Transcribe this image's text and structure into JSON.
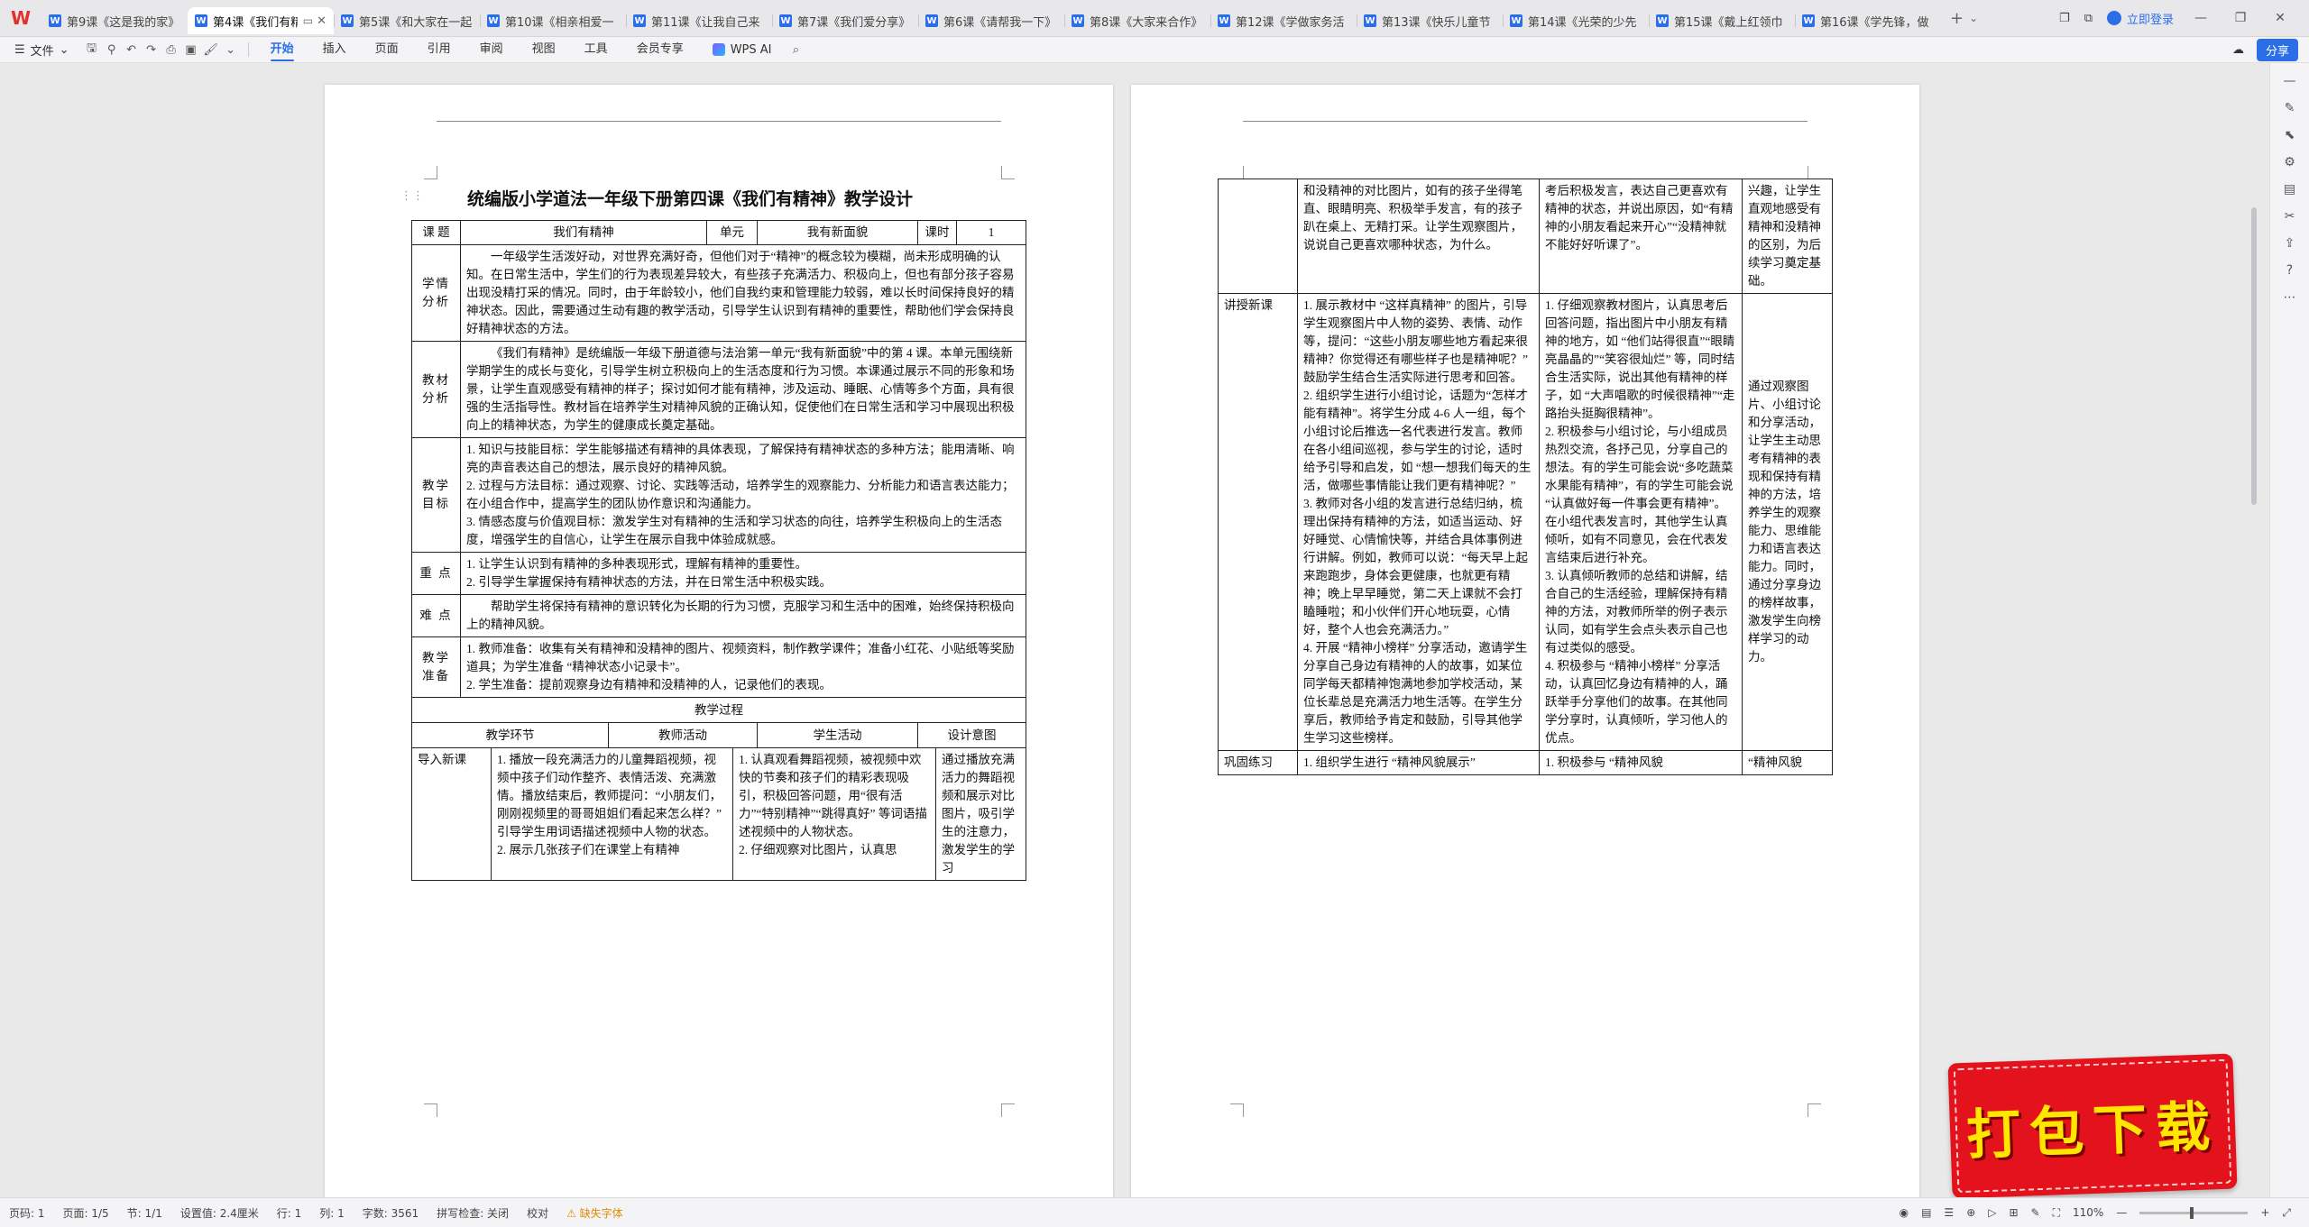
{
  "app": {
    "logo_text": "W",
    "tabs": [
      {
        "label": "第9课《这是我的家》",
        "active": false
      },
      {
        "label": "第4课《我们有精",
        "active": true
      },
      {
        "label": "第5课《和大家在一起",
        "active": false
      },
      {
        "label": "第10课《相亲相爱一",
        "active": false
      },
      {
        "label": "第11课《让我自己来",
        "active": false
      },
      {
        "label": "第7课《我们爱分享》",
        "active": false
      },
      {
        "label": "第6课《请帮我一下》",
        "active": false
      },
      {
        "label": "第8课《大家来合作》",
        "active": false
      },
      {
        "label": "第12课《学做家务活",
        "active": false
      },
      {
        "label": "第13课《快乐儿童节",
        "active": false
      },
      {
        "label": "第14课《光荣的少先",
        "active": false
      },
      {
        "label": "第15课《戴上红领巾",
        "active": false
      },
      {
        "label": "第16课《学先锋，做",
        "active": false
      }
    ],
    "login_label": "立即登录"
  },
  "toolbar": {
    "file_label": "文件",
    "menu": [
      "开始",
      "插入",
      "页面",
      "引用",
      "审阅",
      "视图",
      "工具",
      "会员专享"
    ],
    "active_menu": "开始",
    "wps_ai_label": "WPS AI",
    "share_label": "分享"
  },
  "document": {
    "title": "统编版小学道法一年级下册第四课《我们有精神》教学设计",
    "info_row": {
      "topic_label": "课 题",
      "topic_value": "我们有精神",
      "unit_label": "单元",
      "unit_value": "我有新面貌",
      "hours_label": "课时",
      "hours_value": "1"
    },
    "sections": [
      {
        "label": "学情分析",
        "text": "一年级学生活泼好动，对世界充满好奇，但他们对于“精神”的概念较为模糊，尚未形成明确的认知。在日常生活中，学生们的行为表现差异较大，有些孩子充满活力、积极向上，但也有部分孩子容易出现没精打采的情况。同时，由于年龄较小，他们自我约束和管理能力较弱，难以长时间保持良好的精神状态。因此，需要通过生动有趣的教学活动，引导学生认识到有精神的重要性，帮助他们学会保持良好精神状态的方法。"
      },
      {
        "label": "教材分析",
        "text": "《我们有精神》是统编版一年级下册道德与法治第一单元“我有新面貌”中的第 4 课。本单元围绕新学期学生的成长与变化，引导学生树立积极向上的生活态度和行为习惯。本课通过展示不同的形象和场景，让学生直观感受有精神的样子；探讨如何才能有精神，涉及运动、睡眠、心情等多个方面，具有很强的生活指导性。教材旨在培养学生对精神风貌的正确认知，促使他们在日常生活和学习中展现出积极向上的精神状态，为学生的健康成长奠定基础。"
      }
    ],
    "goals_label": "教学目标",
    "goals": [
      "1. 知识与技能目标：学生能够描述有精神的具体表现，了解保持有精神状态的多种方法；能用清晰、响亮的声音表达自己的想法，展示良好的精神风貌。",
      "2. 过程与方法目标：通过观察、讨论、实践等活动，培养学生的观察能力、分析能力和语言表达能力；在小组合作中，提高学生的团队协作意识和沟通能力。",
      "3. 情感态度与价值观目标：激发学生对有精神的生活和学习状态的向往，培养学生积极向上的生活态度，增强学生的自信心，让学生在展示自我中体验成就感。"
    ],
    "key_label": "重 点",
    "key_points": [
      "1. 让学生认识到有精神的多种表现形式，理解有精神的重要性。",
      "2. 引导学生掌握保持有精神状态的方法，并在日常生活中积极实践。"
    ],
    "difficulty_label": "难 点",
    "difficulty_text": "帮助学生将保持有精神的意识转化为长期的行为习惯，克服学习和生活中的困难，始终保持积极向上的精神风貌。",
    "prep_label": "教学准备",
    "prep": [
      "1. 教师准备：收集有关有精神和没精神的图片、视频资料，制作教学课件；准备小红花、小贴纸等奖励道具；为学生准备 “精神状态小记录卡”。",
      "2. 学生准备：提前观察身边有精神和没精神的人，记录他们的表现。"
    ],
    "process_title": "教学过程",
    "process_headers": [
      "教学环节",
      "教师活动",
      "学生活动",
      "设计意图"
    ],
    "intro": {
      "stage": "导入新课",
      "teacher": "1. 播放一段充满活力的儿童舞蹈视频，视频中孩子们动作整齐、表情活泼、充满激情。播放结束后，教师提问：“小朋友们，刚刚视频里的哥哥姐姐们看起来怎么样？” 引导学生用词语描述视频中人物的状态。\n2. 展示几张孩子们在课堂上有精神",
      "student": "1. 认真观看舞蹈视频，被视频中欢快的节奏和孩子们的精彩表现吸引，积极回答问题，用“很有活力”“特别精神”“跳得真好” 等词语描述视频中的人物状态。\n2. 仔细观察对比图片，认真思",
      "intent": "通过播放充满活力的舞蹈视频和展示对比图片，吸引学生的注意力，激发学生的学习"
    },
    "page2": {
      "cont": {
        "stage": "",
        "teacher": "和没精神的对比图片，如有的孩子坐得笔直、眼睛明亮、积极举手发言，有的孩子趴在桌上、无精打采。让学生观察图片，说说自己更喜欢哪种状态，为什么。",
        "student": "考后积极发言，表达自己更喜欢有精神的状态，并说出原因，如“有精神的小朋友看起来开心”“没精神就不能好好听课了”。",
        "intent": "兴趣，让学生直观地感受有精神和没精神的区别，为后续学习奠定基础。"
      },
      "new": {
        "stage": "讲授新课",
        "teacher": "1. 展示教材中 “这样真精神” 的图片，引导学生观察图片中人物的姿势、表情、动作等，提问：“这些小朋友哪些地方看起来很精神？你觉得还有哪些样子也是精神呢？” 鼓励学生结合生活实际进行思考和回答。\n2. 组织学生进行小组讨论，话题为“怎样才能有精神”。将学生分成 4-6 人一组，每个小组讨论后推选一名代表进行发言。教师在各小组间巡视，参与学生的讨论，适时给予引导和启发，如 “想一想我们每天的生活，做哪些事情能让我们更有精神呢？”\n3. 教师对各小组的发言进行总结归纳，梳理出保持有精神的方法，如适当运动、好好睡觉、心情愉快等，并结合具体事例进行讲解。例如，教师可以说：“每天早上起来跑跑步，身体会更健康，也就更有精神；晚上早早睡觉，第二天上课就不会打瞌睡啦；和小伙伴们开心地玩耍，心情好，整个人也会充满活力。”\n4. 开展 “精神小榜样” 分享活动，邀请学生分享自己身边有精神的人的故事，如某位同学每天都精神饱满地参加学校活动，某位长辈总是充满活力地生活等。在学生分享后，教师给予肯定和鼓励，引导其他学生学习这些榜样。",
        "student": "1. 仔细观察教材图片，认真思考后回答问题，指出图片中小朋友有精神的地方，如 “他们站得很直”“眼睛亮晶晶的”“笑容很灿烂” 等，同时结合生活实际，说出其他有精神的样子，如 “大声唱歌的时候很精神”“走路抬头挺胸很精神”。\n2. 积极参与小组讨论，与小组成员热烈交流，各抒己见，分享自己的想法。有的学生可能会说“多吃蔬菜水果能有精神”，有的学生可能会说 “认真做好每一件事会更有精神”。在小组代表发言时，其他学生认真倾听，如有不同意见，会在代表发言结束后进行补充。\n3. 认真倾听教师的总结和讲解，结合自己的生活经验，理解保持有精神的方法，对教师所举的例子表示认同，如有学生会点头表示自己也有过类似的感受。\n4. 积极参与 “精神小榜样” 分享活动，认真回忆身边有精神的人，踊跃举手分享他们的故事。在其他同学分享时，认真倾听，学习他人的优点。",
        "intent": "通过观察图片、小组讨论和分享活动，让学生主动思考有精神的表现和保持有精神的方法，培养学生的观察能力、思维能力和语言表达能力。同时，通过分享身边的榜样故事，激发学生向榜样学习的动力。"
      },
      "practice": {
        "stage": "巩固练习",
        "teacher": "1. 组织学生进行 “精神风貌展示”",
        "student": "1. 积极参与 “精神风貌",
        "intent": "“精神风貌"
      }
    }
  },
  "download_banner": "打包下载",
  "status": {
    "page": "页码: 1",
    "pages": "页面: 1/5",
    "section": "节: 1/1",
    "setting": "设置值: 2.4厘米",
    "row": "行: 1",
    "col": "列: 1",
    "words": "字数: 3561",
    "spell": "拼写检查: 关闭",
    "proof": "校对",
    "font_warning": "缺失字体",
    "zoom": "110%"
  }
}
